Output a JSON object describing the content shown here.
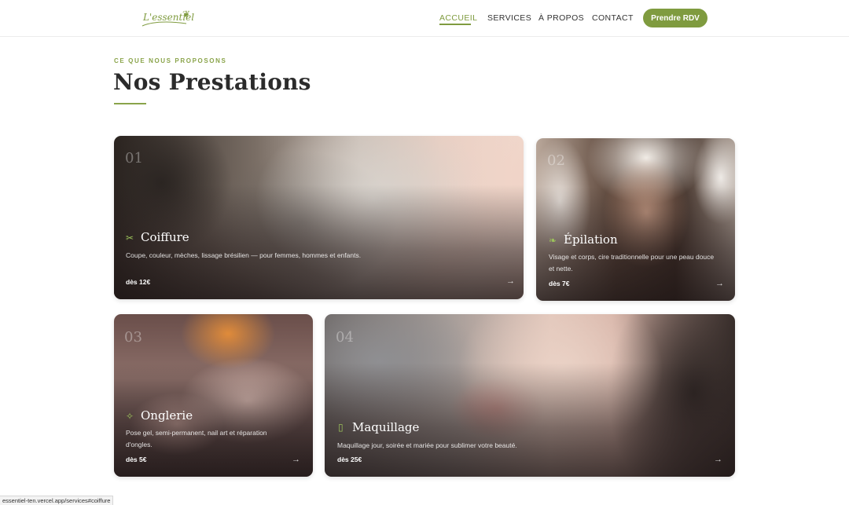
{
  "header": {
    "logo_text": "L'essentiel",
    "nav": [
      {
        "label": "ACCUEIL",
        "active": true
      },
      {
        "label": "SERVICES",
        "active": false
      },
      {
        "label": "À PROPOS",
        "active": false
      },
      {
        "label": "CONTACT",
        "active": false
      }
    ],
    "cta_label": "Prendre RDV"
  },
  "section": {
    "eyebrow": "CE QUE NOUS PROPOSONS",
    "title": "Nos Prestations"
  },
  "cards": [
    {
      "number": "01",
      "title": "Coiffure",
      "icon": "scissors-icon",
      "description": "Coupe, couleur, mèches, lissage brésilien — pour femmes, hommes et enfants.",
      "price": "dès 12€"
    },
    {
      "number": "02",
      "title": "Épilation",
      "icon": "leaf-icon",
      "description": "Visage et corps, cire traditionnelle pour une peau douce et nette.",
      "price": "dès 7€"
    },
    {
      "number": "03",
      "title": "Onglerie",
      "icon": "sparkle-icon",
      "description": "Pose gel, semi-permanent, nail art et réparation d'ongles.",
      "price": "dès 5€"
    },
    {
      "number": "04",
      "title": "Maquillage",
      "icon": "lipstick-icon",
      "description": "Maquillage jour, soirée et mariée pour sublimer votre beauté.",
      "price": "dès 25€"
    }
  ],
  "status_url": "essentiel-ten.vercel.app/services#coiffure",
  "colors": {
    "accent": "#7f9b3f",
    "eyebrow": "#8aa44a"
  }
}
